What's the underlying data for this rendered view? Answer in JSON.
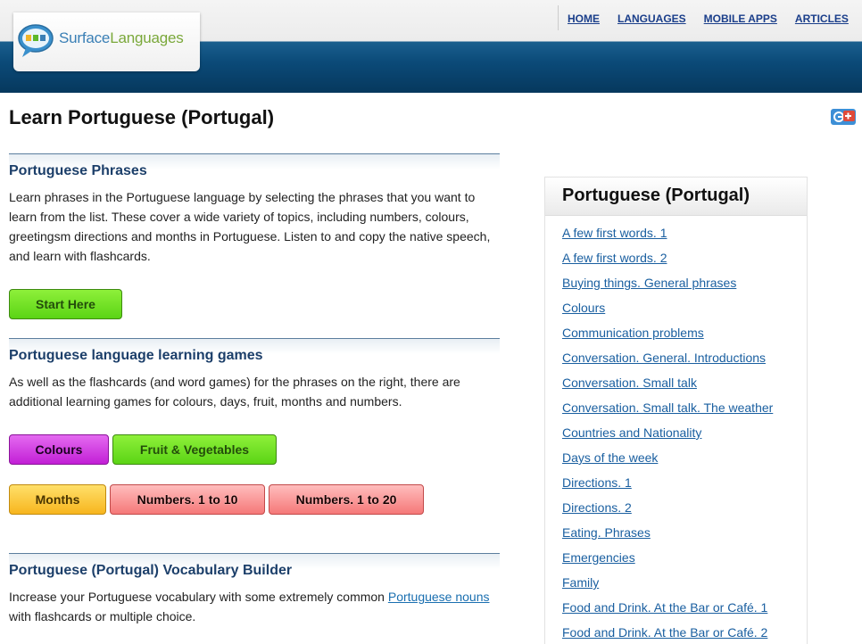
{
  "logo": {
    "text_part1": "Surface",
    "text_part2": "Languages"
  },
  "nav": [
    "HOME",
    "LANGUAGES",
    "MOBILE APPS",
    "ARTICLES"
  ],
  "page_title": "Learn Portuguese (Portugal)",
  "section_phrases": {
    "heading": "Portuguese Phrases",
    "body": "Learn phrases in the Portuguese language by selecting the phrases that you want to learn from the list. These cover a wide variety of topics, including numbers, colours, greetingsm directions and months in Portuguese. Listen to and copy the native speech, and learn with flashcards.",
    "button": "Start Here"
  },
  "section_games": {
    "heading": "Portuguese language learning games",
    "body": "As well as the flashcards (and word games) for the phrases on the right, there are additional learning games for colours, days, fruit, months and numbers.",
    "buttons": [
      "Colours",
      "Fruit & Vegetables",
      "Months",
      "Numbers. 1 to 10",
      "Numbers. 1 to 20"
    ]
  },
  "section_vocab": {
    "heading": "Portuguese (Portugal) Vocabulary Builder",
    "body_before": "Increase your Portuguese vocabulary with some extremely common ",
    "link": "Portuguese nouns",
    "body_after": " with flashcards or multiple choice."
  },
  "sidebar": {
    "title": "Portuguese (Portugal)",
    "items": [
      "A few first words. 1",
      "A few first words. 2",
      "Buying things. General phrases",
      "Colours",
      "Communication problems",
      "Conversation. General. Introductions",
      "Conversation. Small talk",
      "Conversation. Small talk. The weather",
      "Countries and Nationality",
      "Days of the week",
      "Directions. 1",
      "Directions. 2",
      "Eating. Phrases",
      "Emergencies",
      "Family",
      "Food and Drink. At the Bar or Café. 1",
      "Food and Drink. At the Bar or Café. 2"
    ]
  }
}
